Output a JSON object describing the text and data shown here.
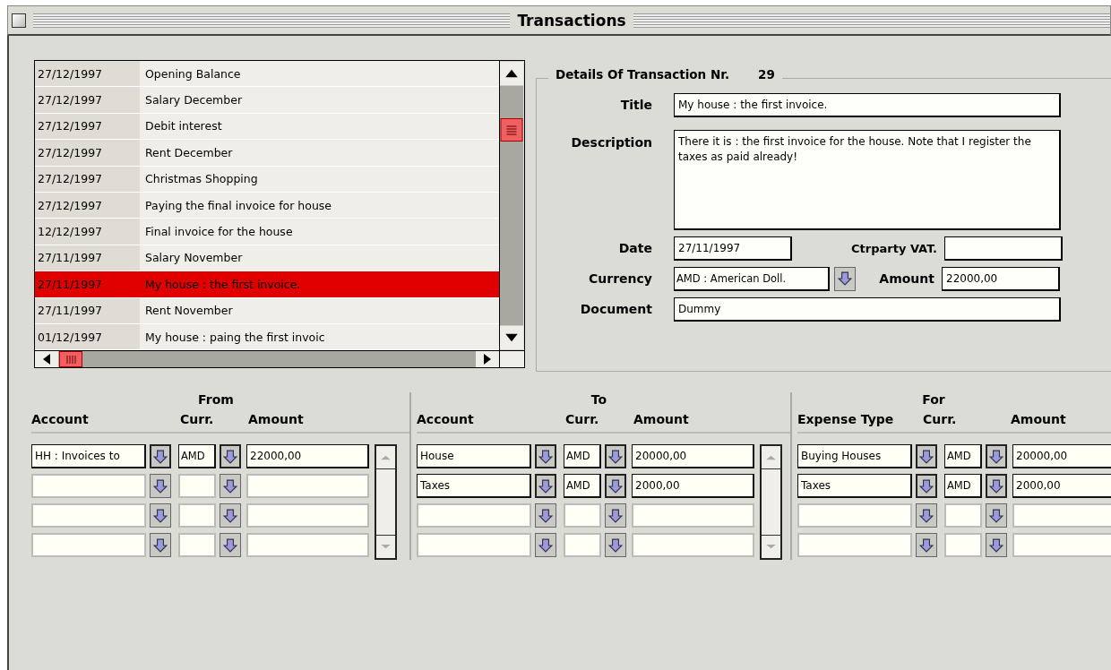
{
  "window": {
    "title": "Transactions"
  },
  "transactions": [
    {
      "date": "27/12/1997",
      "title": "Opening Balance",
      "selected": false
    },
    {
      "date": "27/12/1997",
      "title": "Salary December",
      "selected": false
    },
    {
      "date": "27/12/1997",
      "title": "Debit interest",
      "selected": false
    },
    {
      "date": "27/12/1997",
      "title": "Rent December",
      "selected": false
    },
    {
      "date": "27/12/1997",
      "title": "Christmas Shopping",
      "selected": false
    },
    {
      "date": "27/12/1997",
      "title": "Paying the final invoice for house",
      "selected": false
    },
    {
      "date": "12/12/1997",
      "title": "Final invoice for the house",
      "selected": false
    },
    {
      "date": "27/11/1997",
      "title": "Salary November",
      "selected": false
    },
    {
      "date": "27/11/1997",
      "title": "My house : the first invoice.",
      "selected": true
    },
    {
      "date": "27/11/1997",
      "title": "Rent November",
      "selected": false
    },
    {
      "date": "01/12/1997",
      "title": "My house : paing the first invoic",
      "selected": false
    }
  ],
  "details": {
    "heading": "Details Of Transaction Nr.",
    "number": "29",
    "title": {
      "label": "Title",
      "value": "My house : the first invoice."
    },
    "description": {
      "label": "Description",
      "value": "There it is : the first invoice for the house. Note that I register the taxes as paid already!"
    },
    "date": {
      "label": "Date",
      "value": "27/11/1997"
    },
    "ctrparty_vat": {
      "label": "Ctrparty VAT."
    },
    "currency": {
      "label": "Currency",
      "value": "AMD : American Doll."
    },
    "amount": {
      "label": "Amount",
      "value": "22000,00"
    },
    "document": {
      "label": "Document",
      "value": "Dummy"
    }
  },
  "splits": [
    {
      "heading": "From",
      "columns": [
        "Account",
        "Curr.",
        "Amount"
      ],
      "scrollbar": true,
      "rows": [
        {
          "account": "HH : Invoices to",
          "currency": "AMD",
          "amount": "22000,00"
        },
        {},
        {},
        {}
      ]
    },
    {
      "heading": "To",
      "columns": [
        "Account",
        "Curr.",
        "Amount"
      ],
      "scrollbar": true,
      "rows": [
        {
          "account": "House",
          "currency": "AMD",
          "amount": "20000,00"
        },
        {
          "account": "Taxes",
          "currency": "AMD",
          "amount": "2000,00"
        },
        {},
        {}
      ]
    },
    {
      "heading": "For",
      "columns": [
        "Expense Type",
        "Curr.",
        "Amount"
      ],
      "scrollbar": false,
      "rows": [
        {
          "account": "Buying Houses",
          "currency": "AMD",
          "amount": "20000,00"
        },
        {
          "account": "Taxes",
          "currency": "AMD",
          "amount": "2000,00"
        },
        {},
        {}
      ]
    }
  ]
}
